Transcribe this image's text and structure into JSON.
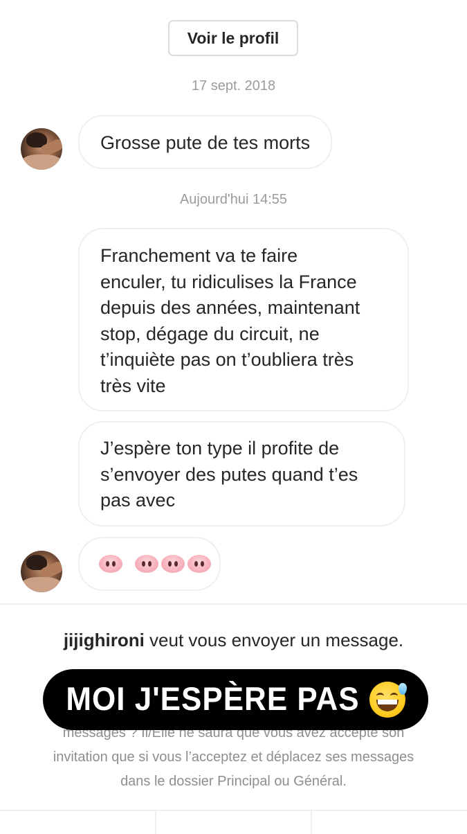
{
  "header": {
    "profile_button": "Voir le profil"
  },
  "timestamps": {
    "first": "17 sept. 2018",
    "second": "Aujourd'hui 14:55"
  },
  "messages": [
    {
      "text": "Grosse pute de tes morts"
    },
    {
      "text": "Franchement va te faire\nenculer, tu ridiculises la France\ndepuis des années, maintenant\nstop, dégage du circuit, ne\nt’inquiète pas on t’oubliera très\ntrès vite"
    },
    {
      "text": "J’espère ton type il profite de\ns’envoyer des putes quand t’es\npas avec"
    },
    {
      "emoji": "pig-nose",
      "count": 4
    }
  ],
  "request": {
    "username": "jijighironi",
    "title_rest": " veut vous envoyer un message.",
    "body_lines": [
      "messages ? Il/Elle ne saura que vous avez accepté son",
      "invitation que si vous l’acceptez et déplacez ses messages",
      "dans le dossier Principal ou Général."
    ]
  },
  "overlay": {
    "caption": "MOI J'ESPÈRE PAS",
    "emoji": "grinning-face-with-sweat"
  }
}
